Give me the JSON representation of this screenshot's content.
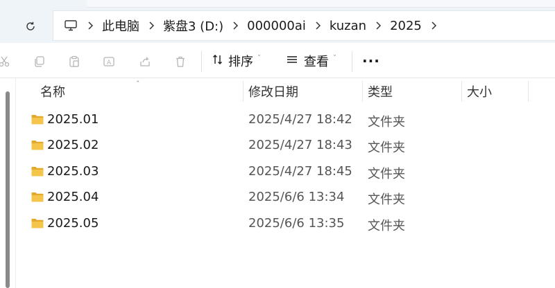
{
  "address": {
    "crumbs": [
      "此电脑",
      "紫盘3 (D:)",
      "000000ai",
      "kuzan",
      "2025"
    ]
  },
  "toolbar": {
    "sort_label": "排序",
    "view_label": "查看",
    "more_label": "···"
  },
  "columns": {
    "name": "名称",
    "date": "修改日期",
    "type": "类型",
    "size": "大小"
  },
  "files": [
    {
      "name": "2025.01",
      "date": "2025/4/27 18:42",
      "type": "文件夹"
    },
    {
      "name": "2025.02",
      "date": "2025/4/27 18:43",
      "type": "文件夹"
    },
    {
      "name": "2025.03",
      "date": "2025/4/27 18:45",
      "type": "文件夹"
    },
    {
      "name": "2025.04",
      "date": "2025/6/6 13:34",
      "type": "文件夹"
    },
    {
      "name": "2025.05",
      "date": "2025/6/6 13:35",
      "type": "文件夹"
    }
  ],
  "colors": {
    "folder": "#f4c54b",
    "folder_tab": "#e3a92a",
    "toolbar_strip": "#eff4f9"
  },
  "icons": [
    "refresh-icon",
    "computer-icon",
    "chevron-right-icon",
    "cut-icon",
    "copy-icon",
    "paste-icon",
    "rename-icon",
    "share-icon",
    "delete-icon",
    "sort-icon",
    "view-icon",
    "folder-icon"
  ]
}
